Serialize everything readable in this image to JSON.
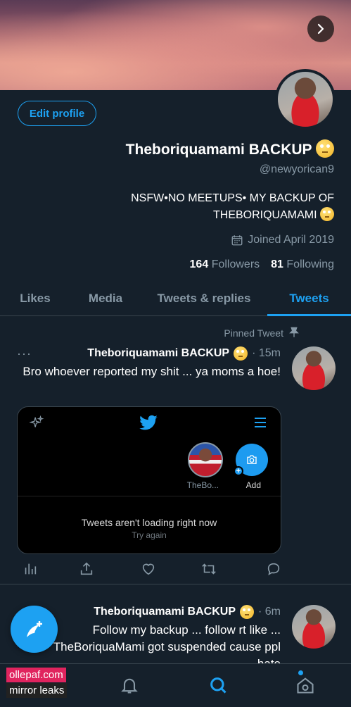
{
  "profile": {
    "edit_label": "Edit profile",
    "display_name": "Theboriquamami BACKUP",
    "handle": "@newyorican9",
    "bio_line1": "NSFW•NO MEETUPS• MY BACKUP OF",
    "bio_line2": "THEBORIQUAMAMI",
    "joined": "Joined April 2019",
    "following_count": "81",
    "following_label": "Following",
    "followers_count": "164",
    "followers_label": "Followers"
  },
  "tabs": [
    {
      "label": "Tweets",
      "active": true
    },
    {
      "label": "Tweets & replies"
    },
    {
      "label": "Media"
    },
    {
      "label": "Likes"
    }
  ],
  "pinned_tweet": {
    "pinned_label": "Pinned Tweet",
    "name": "Theboriquamami BACKUP",
    "time": "· 15m",
    "more": "···",
    "text": "Bro whoever reported my shit ... ya moms a hoe!",
    "embed": {
      "add_label": "Add",
      "user_label": "TheBo...",
      "message": "Tweets aren't loading right now",
      "retry": "Try again"
    }
  },
  "second_tweet": {
    "name": "Theboriquamami BACKUP",
    "time": "· 6m",
    "line1": "Follow my backup ... follow rt like ...",
    "line2": "TheBoriquaMami got suspended cause ppl",
    "line3": "hate"
  },
  "watermark": {
    "line1": "ollepaf.com",
    "line2": "mirror leaks"
  },
  "colors": {
    "background": "#15202b",
    "accent": "#1da1f2",
    "muted": "#8899a6",
    "divider": "#38444d"
  },
  "icons": [
    "chevron-right-icon",
    "calendar-icon",
    "pin-icon",
    "sparkle-icon",
    "twitter-bird-icon",
    "menu-icon",
    "camera-icon",
    "analytics-icon",
    "share-icon",
    "like-icon",
    "retweet-icon",
    "reply-icon",
    "compose-icon",
    "notifications-icon",
    "search-icon",
    "home-icon"
  ]
}
